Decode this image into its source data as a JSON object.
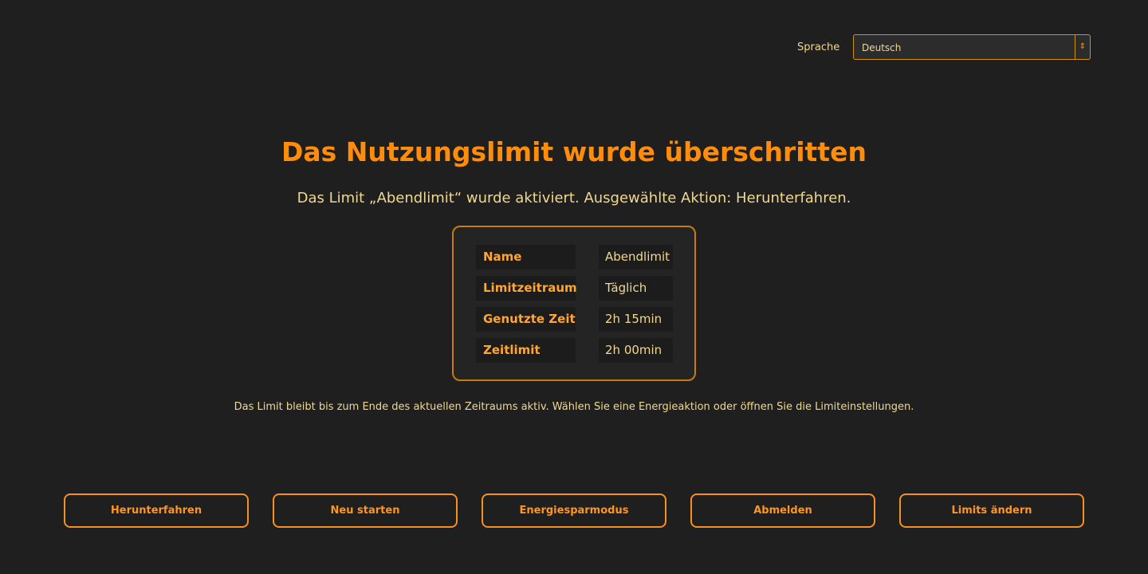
{
  "language": {
    "label": "Sprache",
    "selected": "Deutsch",
    "arrow_icon": "⇕"
  },
  "header": {
    "title": "Das Nutzungslimit wurde überschritten",
    "subtitle": "Das Limit „Abendlimit“ wurde aktiviert. Ausgewählte Aktion: Herunterfahren."
  },
  "details": [
    {
      "label": "Name",
      "value": "Abendlimit"
    },
    {
      "label": "Limitzeitraum",
      "value": "Täglich"
    },
    {
      "label": "Genutzte Zeit",
      "value": "2h 15min"
    },
    {
      "label": "Zeitlimit",
      "value": "2h 00min"
    }
  ],
  "note": "Das Limit bleibt bis zum Ende des aktuellen Zeitraums aktiv. Wählen Sie eine Energieaktion oder öffnen Sie die Limiteinstellungen.",
  "actions": [
    {
      "label": "Herunterfahren"
    },
    {
      "label": "Neu starten"
    },
    {
      "label": "Energiesparmodus"
    },
    {
      "label": "Abmelden"
    },
    {
      "label": "Limits ändern"
    }
  ],
  "colors": {
    "background": "#1f1f1f",
    "accent": "#ff8c0a",
    "text": "#f0d890",
    "label": "#ffa532",
    "border": "#c77c10"
  }
}
